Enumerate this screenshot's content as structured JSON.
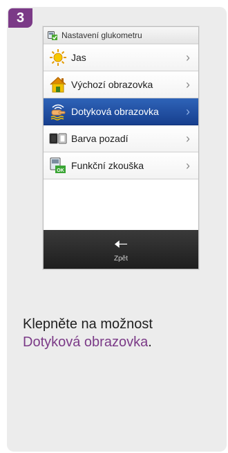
{
  "step": "3",
  "device": {
    "title": "Nastavení glukometru",
    "items": [
      {
        "label": "Jas",
        "icon": "sun-icon",
        "selected": false
      },
      {
        "label": "Výchozí obrazovka",
        "icon": "home-icon",
        "selected": false
      },
      {
        "label": "Dotyková obrazovka",
        "icon": "touchscreen-icon",
        "selected": true
      },
      {
        "label": "Barva pozadí",
        "icon": "background-color-icon",
        "selected": false
      },
      {
        "label": "Funkční zkouška",
        "icon": "function-test-icon",
        "selected": false
      }
    ],
    "back_label": "Zpět"
  },
  "instruction": {
    "text": "Klepněte na možnost",
    "highlight": "Dotyková obrazovka",
    "suffix": "."
  },
  "colors": {
    "accent": "#7b3a87",
    "selected": "#1f4ea2"
  }
}
